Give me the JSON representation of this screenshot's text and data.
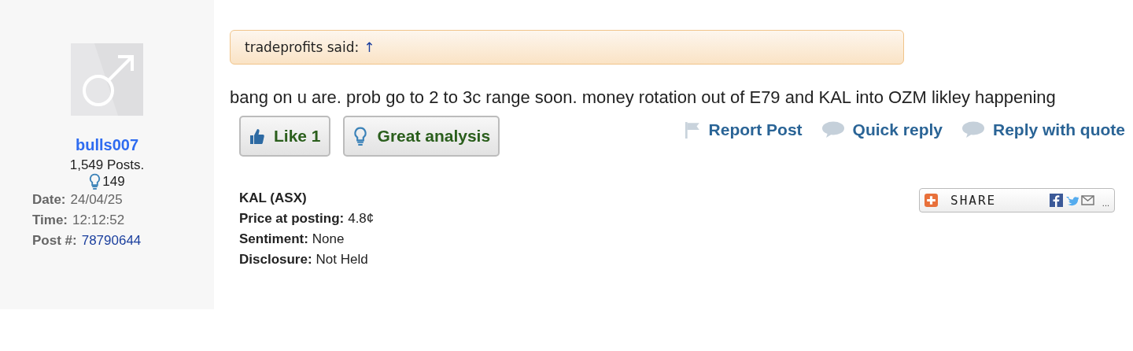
{
  "author": {
    "username": "bulls007",
    "posts": "1,549 Posts.",
    "insights": "149",
    "meta": [
      {
        "kind": "text",
        "label": "Date:",
        "value": "24/04/25"
      },
      {
        "kind": "text",
        "label": "Time:",
        "value": "12:12:52"
      },
      {
        "kind": "link",
        "label": "Post #:",
        "value": "78790644"
      }
    ]
  },
  "quote": {
    "author": "tradeprofits said:",
    "arrow": "↑"
  },
  "body": "bang on u are. prob go to 2 to 3c range soon. money rotation out of E79 and KAL into OZM likley happening",
  "reactions": [
    {
      "kind": "like",
      "label": "Like 1"
    },
    {
      "kind": "insight",
      "label": "Great analysis"
    }
  ],
  "actions": [
    {
      "kind": "report",
      "label": "Report Post"
    },
    {
      "kind": "reply",
      "label": "Quick reply"
    },
    {
      "kind": "reply",
      "label": "Reply with quote"
    }
  ],
  "stock": {
    "code": "KAL (ASX)",
    "fields": [
      {
        "label": "Price at posting:",
        "value": "4.8¢"
      },
      {
        "label": "Sentiment:",
        "value": "None"
      },
      {
        "label": "Disclosure:",
        "value": "Not Held"
      }
    ]
  },
  "share": {
    "label": "SHARE",
    "more": "..."
  }
}
